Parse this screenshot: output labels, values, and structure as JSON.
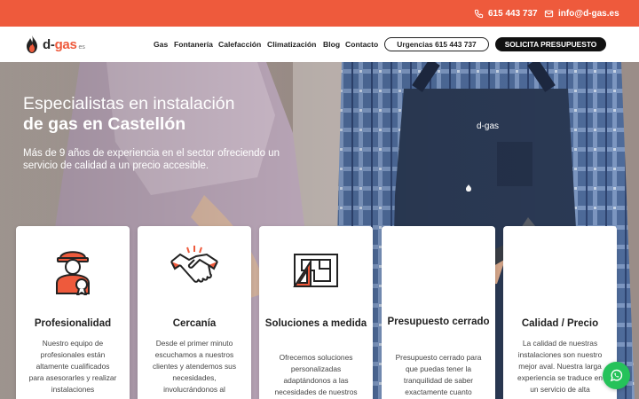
{
  "topbar": {
    "phone": "615 443 737",
    "email": "info@d-gas.es",
    "background": "#ee5a3c",
    "phone_icon": "phone-icon",
    "email_icon": "mail-icon"
  },
  "nav": {
    "logo_text_d": "d-",
    "logo_text_gas": "gas",
    "logo_suffix": "es",
    "items": [
      "Gas",
      "Fontanería",
      "Calefacción",
      "Climatización",
      "Blog",
      "Contacto"
    ],
    "urgent_button": "Urgencias 615 443 737",
    "quote_button": "SOLICITA PRESUPUESTO"
  },
  "hero": {
    "title_line1": "Especialistas en instalación",
    "title_line2": "de gas en Castellón",
    "subtitle": "Más de 9 años de experiencia en el sector ofreciendo un servicio de calidad a un precio accesible.",
    "overalls_brand": "d-gas"
  },
  "cards": [
    {
      "title": "Profesionalidad",
      "text": "Nuestro equipo de profesionales están altamente cualificados para asesorarles y realizar instalaciones",
      "icon": "worker-award-icon"
    },
    {
      "title": "Cercanía",
      "text": "Desde el primer minuto escuchamos a nuestros clientes y atendemos sus necesidades, involucrándonos al",
      "icon": "handshake-icon"
    },
    {
      "title": "Soluciones a medida",
      "text": "Ofrecemos soluciones personalizadas adaptándonos a las necesidades de nuestros",
      "icon": "blueprint-icon"
    },
    {
      "title": "Presupuesto cerrado",
      "text": "Presupuesto cerrado para que puedas tener la tranquilidad de saber exactamente cuanto",
      "icon": "budget-icon"
    },
    {
      "title": "Calidad / Precio",
      "text": "La calidad de nuestras instalaciones son nuestro mejor aval. Nuestra larga experiencia se traduce en un servicio de alta",
      "icon": "quality-icon"
    }
  ],
  "colors": {
    "accent": "#ee5a3c",
    "whatsapp": "#25c25a",
    "dark": "#111111"
  },
  "whatsapp": {
    "icon": "whatsapp-icon"
  }
}
